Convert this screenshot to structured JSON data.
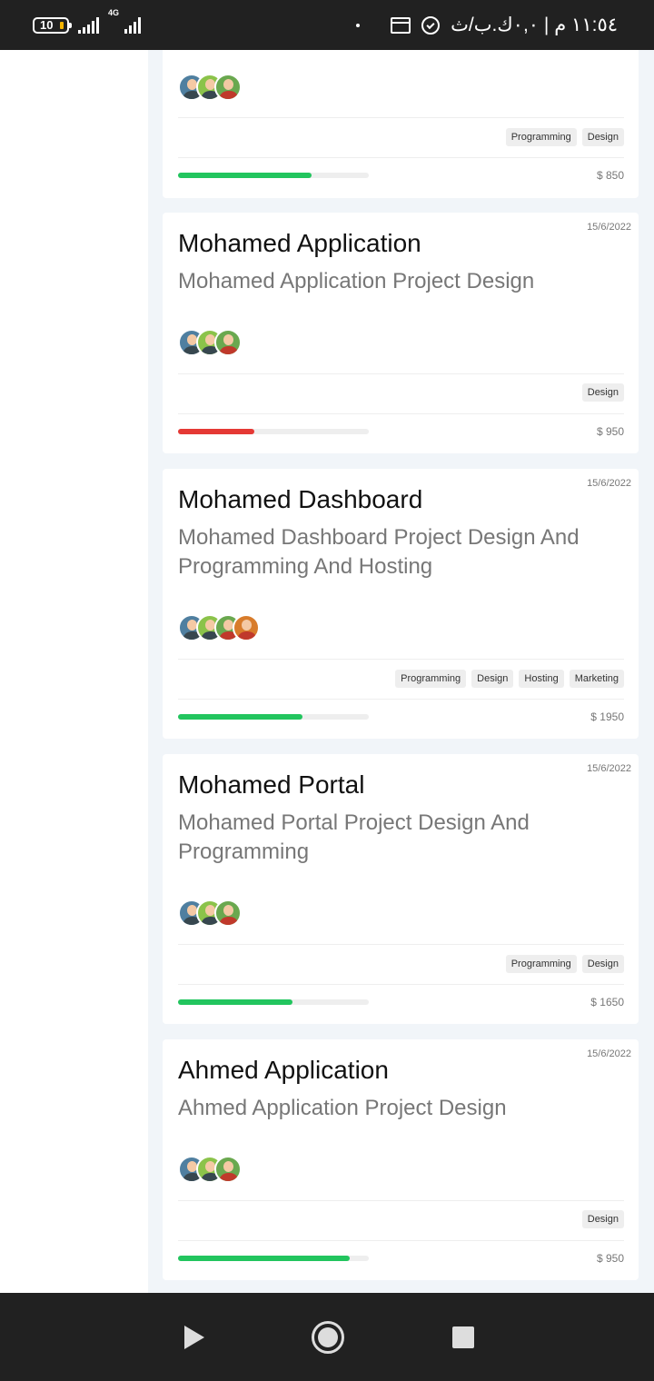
{
  "status_bar": {
    "battery": "10",
    "network": "4G",
    "right_text": "١١:٥٤ م | ٠,٠ك.ب/ث",
    "icons": [
      "dot",
      "calendar-icon",
      "alarm-icon"
    ]
  },
  "cards": [
    {
      "tags": [
        "Programming",
        "Design"
      ],
      "price": "$ 850",
      "progress": 0.7,
      "progress_color": "#22c55e",
      "avatars": 3
    },
    {
      "date": "15/6/2022",
      "title": "Mohamed Application",
      "desc": "Mohamed Application Project Design",
      "tags": [
        "Design"
      ],
      "price": "$ 950",
      "progress": 0.4,
      "progress_color": "#e53935",
      "avatars": 3
    },
    {
      "date": "15/6/2022",
      "title": "Mohamed Dashboard",
      "desc": "Mohamed Dashboard Project Design And Programming And Hosting",
      "tags": [
        "Programming",
        "Design",
        "Hosting",
        "Marketing"
      ],
      "price": "$ 1950",
      "progress": 0.65,
      "progress_color": "#22c55e",
      "avatars": 4
    },
    {
      "date": "15/6/2022",
      "title": "Mohamed Portal",
      "desc": "Mohamed Portal Project Design And Programming",
      "tags": [
        "Programming",
        "Design"
      ],
      "price": "$ 1650",
      "progress": 0.6,
      "progress_color": "#22c55e",
      "avatars": 3
    },
    {
      "date": "15/6/2022",
      "title": "Ahmed Application",
      "desc": "Ahmed Application Project Design",
      "tags": [
        "Design"
      ],
      "price": "$ 950",
      "progress": 0.9,
      "progress_color": "#22c55e",
      "avatars": 3
    }
  ],
  "nav": {
    "icons": [
      "back-icon",
      "home-icon",
      "recents-icon"
    ]
  }
}
